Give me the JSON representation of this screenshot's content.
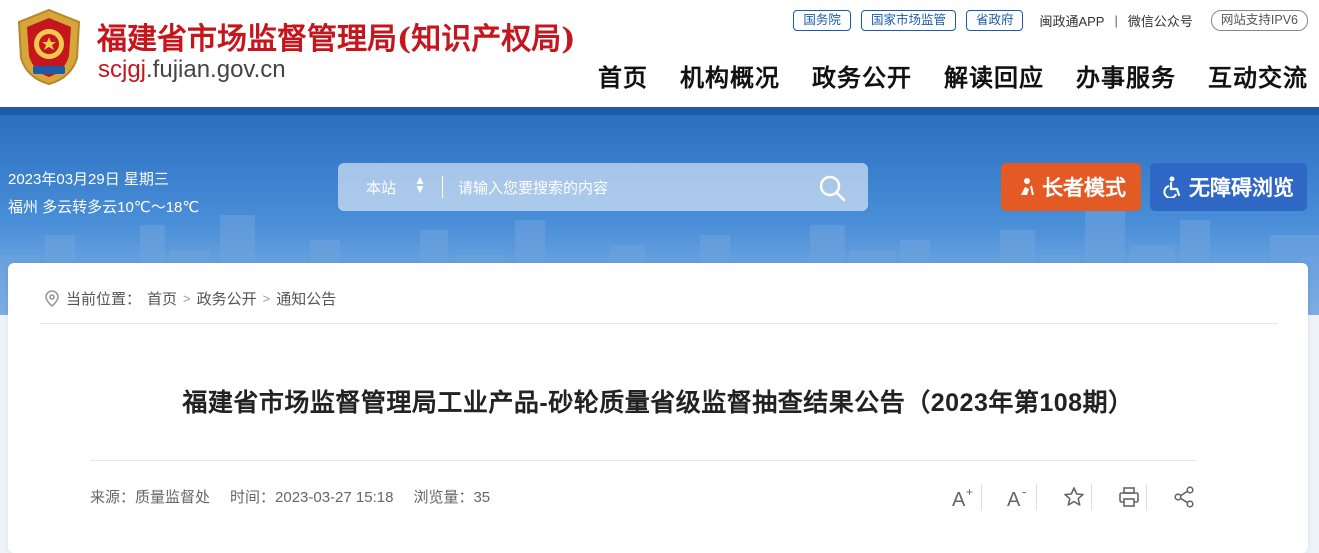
{
  "header": {
    "site_title": "福建省市场监督管理局(知识产权局)",
    "domain_highlight": "scjgj",
    "domain_rest": ".fujian.gov.cn",
    "top_links": [
      "国务院",
      "国家市场监管",
      "省政府"
    ],
    "app_link": "闽政通APP",
    "wechat_link": "微信公众号",
    "ipv6_badge": "网站支持IPV6",
    "separator": "|",
    "nav": [
      "首页",
      "机构概况",
      "政务公开",
      "解读回应",
      "办事服务",
      "互动交流"
    ]
  },
  "banner": {
    "date": "2023年03月29日  星期三",
    "weather": "福州 多云转多云10℃～18℃",
    "search": {
      "scope": "本站",
      "placeholder": "请输入您要搜索的内容"
    },
    "elder_mode_label": "长者模式",
    "accessible_label": "无障碍浏览"
  },
  "breadcrumb": {
    "prefix": "当前位置：",
    "items": [
      "首页",
      "政务公开",
      "通知公告"
    ],
    "gt": ">"
  },
  "article": {
    "title": "福建省市场监督管理局工业产品-砂轮质量省级监督抽查结果公告（2023年第108期）",
    "source": "来源：质量监督处",
    "time": "时间：2023-03-27 15:18",
    "views": "浏览量：35"
  },
  "colors": {
    "brand_red": "#c4161c",
    "brand_blue": "#1d5aa8",
    "elder_orange": "#e45a24",
    "access_blue": "#2f67c4"
  },
  "icons": [
    "emblem-icon",
    "search-icon",
    "elder-icon",
    "accessibility-icon",
    "location-icon",
    "font-increase-icon",
    "font-decrease-icon",
    "star-icon",
    "print-icon",
    "share-icon"
  ]
}
